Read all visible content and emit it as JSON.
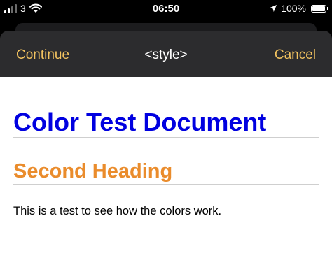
{
  "status_bar": {
    "carrier_signal": "3",
    "time": "06:50",
    "battery_percent": "100%",
    "battery_level": 1.0,
    "icons": [
      "signal-bars-icon",
      "wifi-icon",
      "location-arrow-icon",
      "battery-icon"
    ]
  },
  "nav": {
    "continue_label": "Continue",
    "title": "<style>",
    "cancel_label": "Cancel"
  },
  "document": {
    "heading1": "Color Test Document",
    "heading2": "Second Heading",
    "paragraph": "This is a test to see how the colors work."
  },
  "colors": {
    "nav_accent": "#f4c460",
    "heading1": "#0000e0",
    "heading2": "#ea8c2c",
    "nav_background": "#2c2c2e"
  }
}
